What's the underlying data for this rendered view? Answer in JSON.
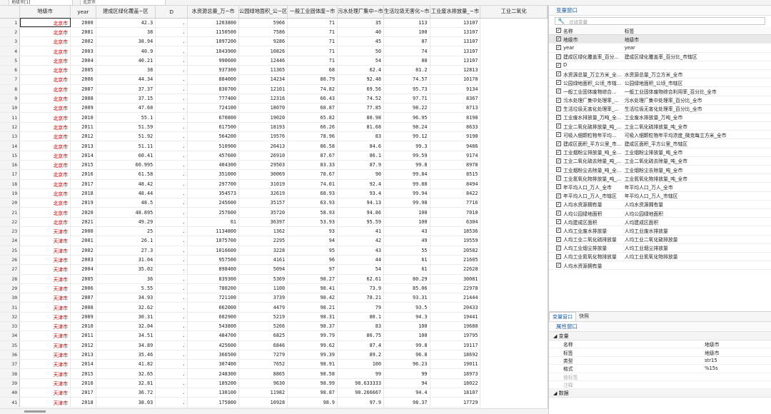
{
  "topbar": {
    "cell1": "地级市[1]",
    "cell2": "北京市"
  },
  "grid": {
    "columns": [
      "地级市",
      "year",
      "建成区绿化覆盖~区",
      "D",
      "水资源总量_万~市",
      "公园绿地面积_公~区",
      "一般工业固体废~市",
      "污水处理厂集中~市",
      "生活垃圾无害化~市",
      "工业废水排放量_~市",
      "工业二氧化"
    ],
    "rows": [
      [
        "1",
        "北京市",
        "2000",
        "42.3",
        ".",
        "1203800",
        "5966",
        "71",
        "35",
        "113",
        "13107"
      ],
      [
        "2",
        "北京市",
        "2001",
        "38",
        ".",
        "1150500",
        "7586",
        "71",
        "40",
        "100",
        "13107"
      ],
      [
        "3",
        "北京市",
        "2002",
        "38.94",
        ".",
        "1097200",
        "9286",
        "71",
        "45",
        "87",
        "13107"
      ],
      [
        "4",
        "北京市",
        "2003",
        "40.9",
        ".",
        "1043900",
        "10826",
        "71",
        "50",
        "74",
        "13107"
      ],
      [
        "5",
        "北京市",
        "2004",
        "40.21",
        ".",
        "990600",
        "12446",
        "71",
        "54",
        "88",
        "13107"
      ],
      [
        "6",
        "北京市",
        "2005",
        "38",
        ".",
        "937300",
        "11365",
        "68",
        "62.4",
        "81.2",
        "12813"
      ],
      [
        "7",
        "北京市",
        "2006",
        "44.34",
        ".",
        "884000",
        "14234",
        "80.79",
        "92.48",
        "74.57",
        "10170"
      ],
      [
        "8",
        "北京市",
        "2007",
        "37.37",
        ".",
        "830700",
        "12101",
        "74.82",
        "69.56",
        "95.73",
        "9134"
      ],
      [
        "9",
        "北京市",
        "2008",
        "37.15",
        ".",
        "777400",
        "12316",
        "66.43",
        "74.52",
        "97.71",
        "8367"
      ],
      [
        "10",
        "北京市",
        "2009",
        "47.68",
        ".",
        "724100",
        "18070",
        "68.87",
        "77.85",
        "98.22",
        "8713"
      ],
      [
        "11",
        "北京市",
        "2010",
        "55.1",
        ".",
        "670800",
        "19020",
        "65.82",
        "80.98",
        "96.95",
        "8198"
      ],
      [
        "12",
        "北京市",
        "2011",
        "51.59",
        ".",
        "617500",
        "18193",
        "66.26",
        "81.68",
        "98.24",
        "8633"
      ],
      [
        "13",
        "北京市",
        "2012",
        "51.92",
        ".",
        "564200",
        "19576",
        "78.96",
        "83",
        "99.12",
        "9190"
      ],
      [
        "14",
        "北京市",
        "2013",
        "51.11",
        ".",
        "510900",
        "20413",
        "86.58",
        "84.6",
        "99.3",
        "9486"
      ],
      [
        "15",
        "北京市",
        "2014",
        "60.41",
        ".",
        "457600",
        "26910",
        "87.67",
        "86.1",
        "99.59",
        "9174"
      ],
      [
        "16",
        "北京市",
        "2015",
        "60.995",
        ".",
        "404300",
        "29503",
        "83.33",
        "87.9",
        "99.8",
        "8978"
      ],
      [
        "17",
        "北京市",
        "2016",
        "61.58",
        ".",
        "351000",
        "30069",
        "78.67",
        "90",
        "99.84",
        "8515"
      ],
      [
        "18",
        "北京市",
        "2017",
        "48.42",
        ".",
        "297700",
        "31019",
        "74.01",
        "92.4",
        "99.88",
        "8494"
      ],
      [
        "19",
        "北京市",
        "2018",
        "48.44",
        ".",
        "354573",
        "32619",
        "68.93",
        "93.4",
        "99.94",
        "8422"
      ],
      [
        "20",
        "北京市",
        "2019",
        "48.5",
        ".",
        "245600",
        "35157",
        "63.93",
        "94.13",
        "99.98",
        "7716"
      ],
      [
        "21",
        "北京市",
        "2020",
        "48.895",
        ".",
        "257600",
        "35720",
        "58.93",
        "94.86",
        "100",
        "7010"
      ],
      [
        "22",
        "北京市",
        "2021",
        "49.29",
        ".",
        "61",
        "36397",
        "53.93",
        "95.59",
        "100",
        "6304"
      ],
      [
        "23",
        "天津市",
        "2000",
        "25",
        ".",
        "1134800",
        "1362",
        "93",
        "41",
        "43",
        "18536"
      ],
      [
        "24",
        "天津市",
        "2001",
        "26.1",
        ".",
        "1075700",
        "2295",
        "94",
        "42",
        "49",
        "19559"
      ],
      [
        "25",
        "天津市",
        "2002",
        "27.3",
        ".",
        "1016600",
        "3228",
        "95",
        "43",
        "55",
        "20582"
      ],
      [
        "26",
        "天津市",
        "2003",
        "31.04",
        ".",
        "957500",
        "4161",
        "96",
        "44",
        "61",
        "21605"
      ],
      [
        "27",
        "天津市",
        "2004",
        "35.02",
        ".",
        "898400",
        "5094",
        "97",
        "54",
        "61",
        "22628"
      ],
      [
        "28",
        "天津市",
        "2005",
        "36",
        ".",
        "839300",
        "5369",
        "98.27",
        "62.61",
        "80.29",
        "30081"
      ],
      [
        "29",
        "天津市",
        "2006",
        "5.55",
        ".",
        "780200",
        "1100",
        "98.41",
        "73.9",
        "85.06",
        "22978"
      ],
      [
        "30",
        "天津市",
        "2007",
        "34.93",
        ".",
        "721100",
        "3739",
        "98.42",
        "78.21",
        "93.31",
        "21444"
      ],
      [
        "31",
        "天津市",
        "2008",
        "32.62",
        ".",
        "662000",
        "4479",
        "98.21",
        "79",
        "93.5",
        "20433"
      ],
      [
        "32",
        "天津市",
        "2009",
        "30.31",
        ".",
        "602900",
        "5219",
        "98.31",
        "80.1",
        "94.3",
        "19441"
      ],
      [
        "33",
        "天津市",
        "2010",
        "32.04",
        ".",
        "543800",
        "5266",
        "98.37",
        "83",
        "100",
        "19680"
      ],
      [
        "34",
        "天津市",
        "2011",
        "34.51",
        ".",
        "484700",
        "6825",
        "99.79",
        "86.75",
        "100",
        "19795"
      ],
      [
        "35",
        "天津市",
        "2012",
        "34.89",
        ".",
        "425600",
        "6846",
        "99.62",
        "87.4",
        "99.8",
        "19117"
      ],
      [
        "36",
        "天津市",
        "2013",
        "35.46",
        ".",
        "366500",
        "7279",
        "99.39",
        "89.2",
        "96.8",
        "18692"
      ],
      [
        "37",
        "天津市",
        "2014",
        "41.82",
        ".",
        "307400",
        "7652",
        "98.91",
        "100",
        "96.23",
        "19011"
      ],
      [
        "38",
        "天津市",
        "2015",
        "32.65",
        ".",
        "248300",
        "8865",
        "98.58",
        "99",
        "99",
        "18973"
      ],
      [
        "39",
        "天津市",
        "2016",
        "32.81",
        ".",
        "189200",
        "9630",
        "98.99",
        "98.633333",
        "94",
        "18022"
      ],
      [
        "40",
        "天津市",
        "2017",
        "36.72",
        ".",
        "130100",
        "11982",
        "98.87",
        "98.266667",
        "94.4",
        "18107"
      ],
      [
        "41",
        "天津市",
        "2018",
        "38.03",
        ".",
        "175800",
        "10928",
        "98.9",
        "97.9",
        "98.37",
        "17729"
      ]
    ]
  },
  "variables": {
    "title": "变量窗口",
    "filter_placeholder": "过滤变量",
    "col_name": "名称",
    "col_label": "标签",
    "items": [
      {
        "name": "地级市",
        "label": "地级市"
      },
      {
        "name": "year",
        "label": "year"
      },
      {
        "name": "建成区绿化覆盖率_百分...",
        "label": "建成区绿化覆盖率_百分比_市辖区"
      },
      {
        "name": "D",
        "label": ""
      },
      {
        "name": "水资源总量_万立方米_全...",
        "label": "水资源总量_万立方米_全市"
      },
      {
        "name": "公园绿地面积_公顷_市辖...",
        "label": "公园绿地面积_公顷_市辖区"
      },
      {
        "name": "一般工业固体废物综合...",
        "label": "一般工业固体废物综合利用率_百分比_全市"
      },
      {
        "name": "污水处理厂集中处理率_...",
        "label": "污水处理厂集中处理率_百分比_全市"
      },
      {
        "name": "生活垃圾无害化处理率_...",
        "label": "生活垃圾无害化处理率_百分比_全市"
      },
      {
        "name": "工业废水排放量_万吨_全...",
        "label": "工业废水排放量_万吨_全市"
      },
      {
        "name": "工业二氧化硫排放量_吨_...",
        "label": "工业二氧化硫排放量_吨_全市"
      },
      {
        "name": "可吸入细颗粒物年平均...",
        "label": "可吸入细颗粒物年平均浓度_微克每立方米_全市"
      },
      {
        "name": "建成区面积_平方公里_市...",
        "label": "建成区面积_平方公里_市辖区"
      },
      {
        "name": "工业烟粉尘排放量_吨_全...",
        "label": "工业烟粉尘排放量_吨_全市"
      },
      {
        "name": "工业二氧化硫去除量_吨_...",
        "label": "工业二氧化硫去除量_吨_全市"
      },
      {
        "name": "工业烟粉尘去除量_吨_全...",
        "label": "工业烟粉尘去除量_吨_全市"
      },
      {
        "name": "工业氮氧化物排放量_吨_...",
        "label": "工业氮氧化物排放量_吨_全市"
      },
      {
        "name": "年平均人口_万人_全市",
        "label": "年平均人口_万人_全市"
      },
      {
        "name": "年平均人口_万人_市辖区",
        "label": "年平均人口_万人_市辖区"
      },
      {
        "name": "人均水资源拥有量",
        "label": "人均水资源拥有量"
      },
      {
        "name": "人均公园绿地面积",
        "label": "人均公园绿地面积"
      },
      {
        "name": "人均建成区面积",
        "label": "人均建成区面积"
      },
      {
        "name": "人均工业废水排放量",
        "label": "人均工业废水排放量"
      },
      {
        "name": "人均工业二氧化硫排放量",
        "label": "人均工业二氧化硫排放量"
      },
      {
        "name": "人均工业烟尘排放量",
        "label": "人均工业烟尘排放量"
      },
      {
        "name": "人均工业氮氧化物排放量",
        "label": "人均工业氮氧化物排放量"
      },
      {
        "name": "人均水资源拥有量",
        "label": ""
      }
    ]
  },
  "tabs": [
    "变量窗口",
    "快照"
  ],
  "props": {
    "title": "属性窗口",
    "group_var": "变量",
    "rows": [
      {
        "name": "名称",
        "value": "地级市"
      },
      {
        "name": "标签",
        "value": "地级市"
      },
      {
        "name": "类型",
        "value": "str15"
      },
      {
        "name": "格式",
        "value": "%15s"
      },
      {
        "name": "值标签",
        "value": ""
      },
      {
        "name": "注释",
        "value": ""
      }
    ],
    "group_data": "数据"
  }
}
